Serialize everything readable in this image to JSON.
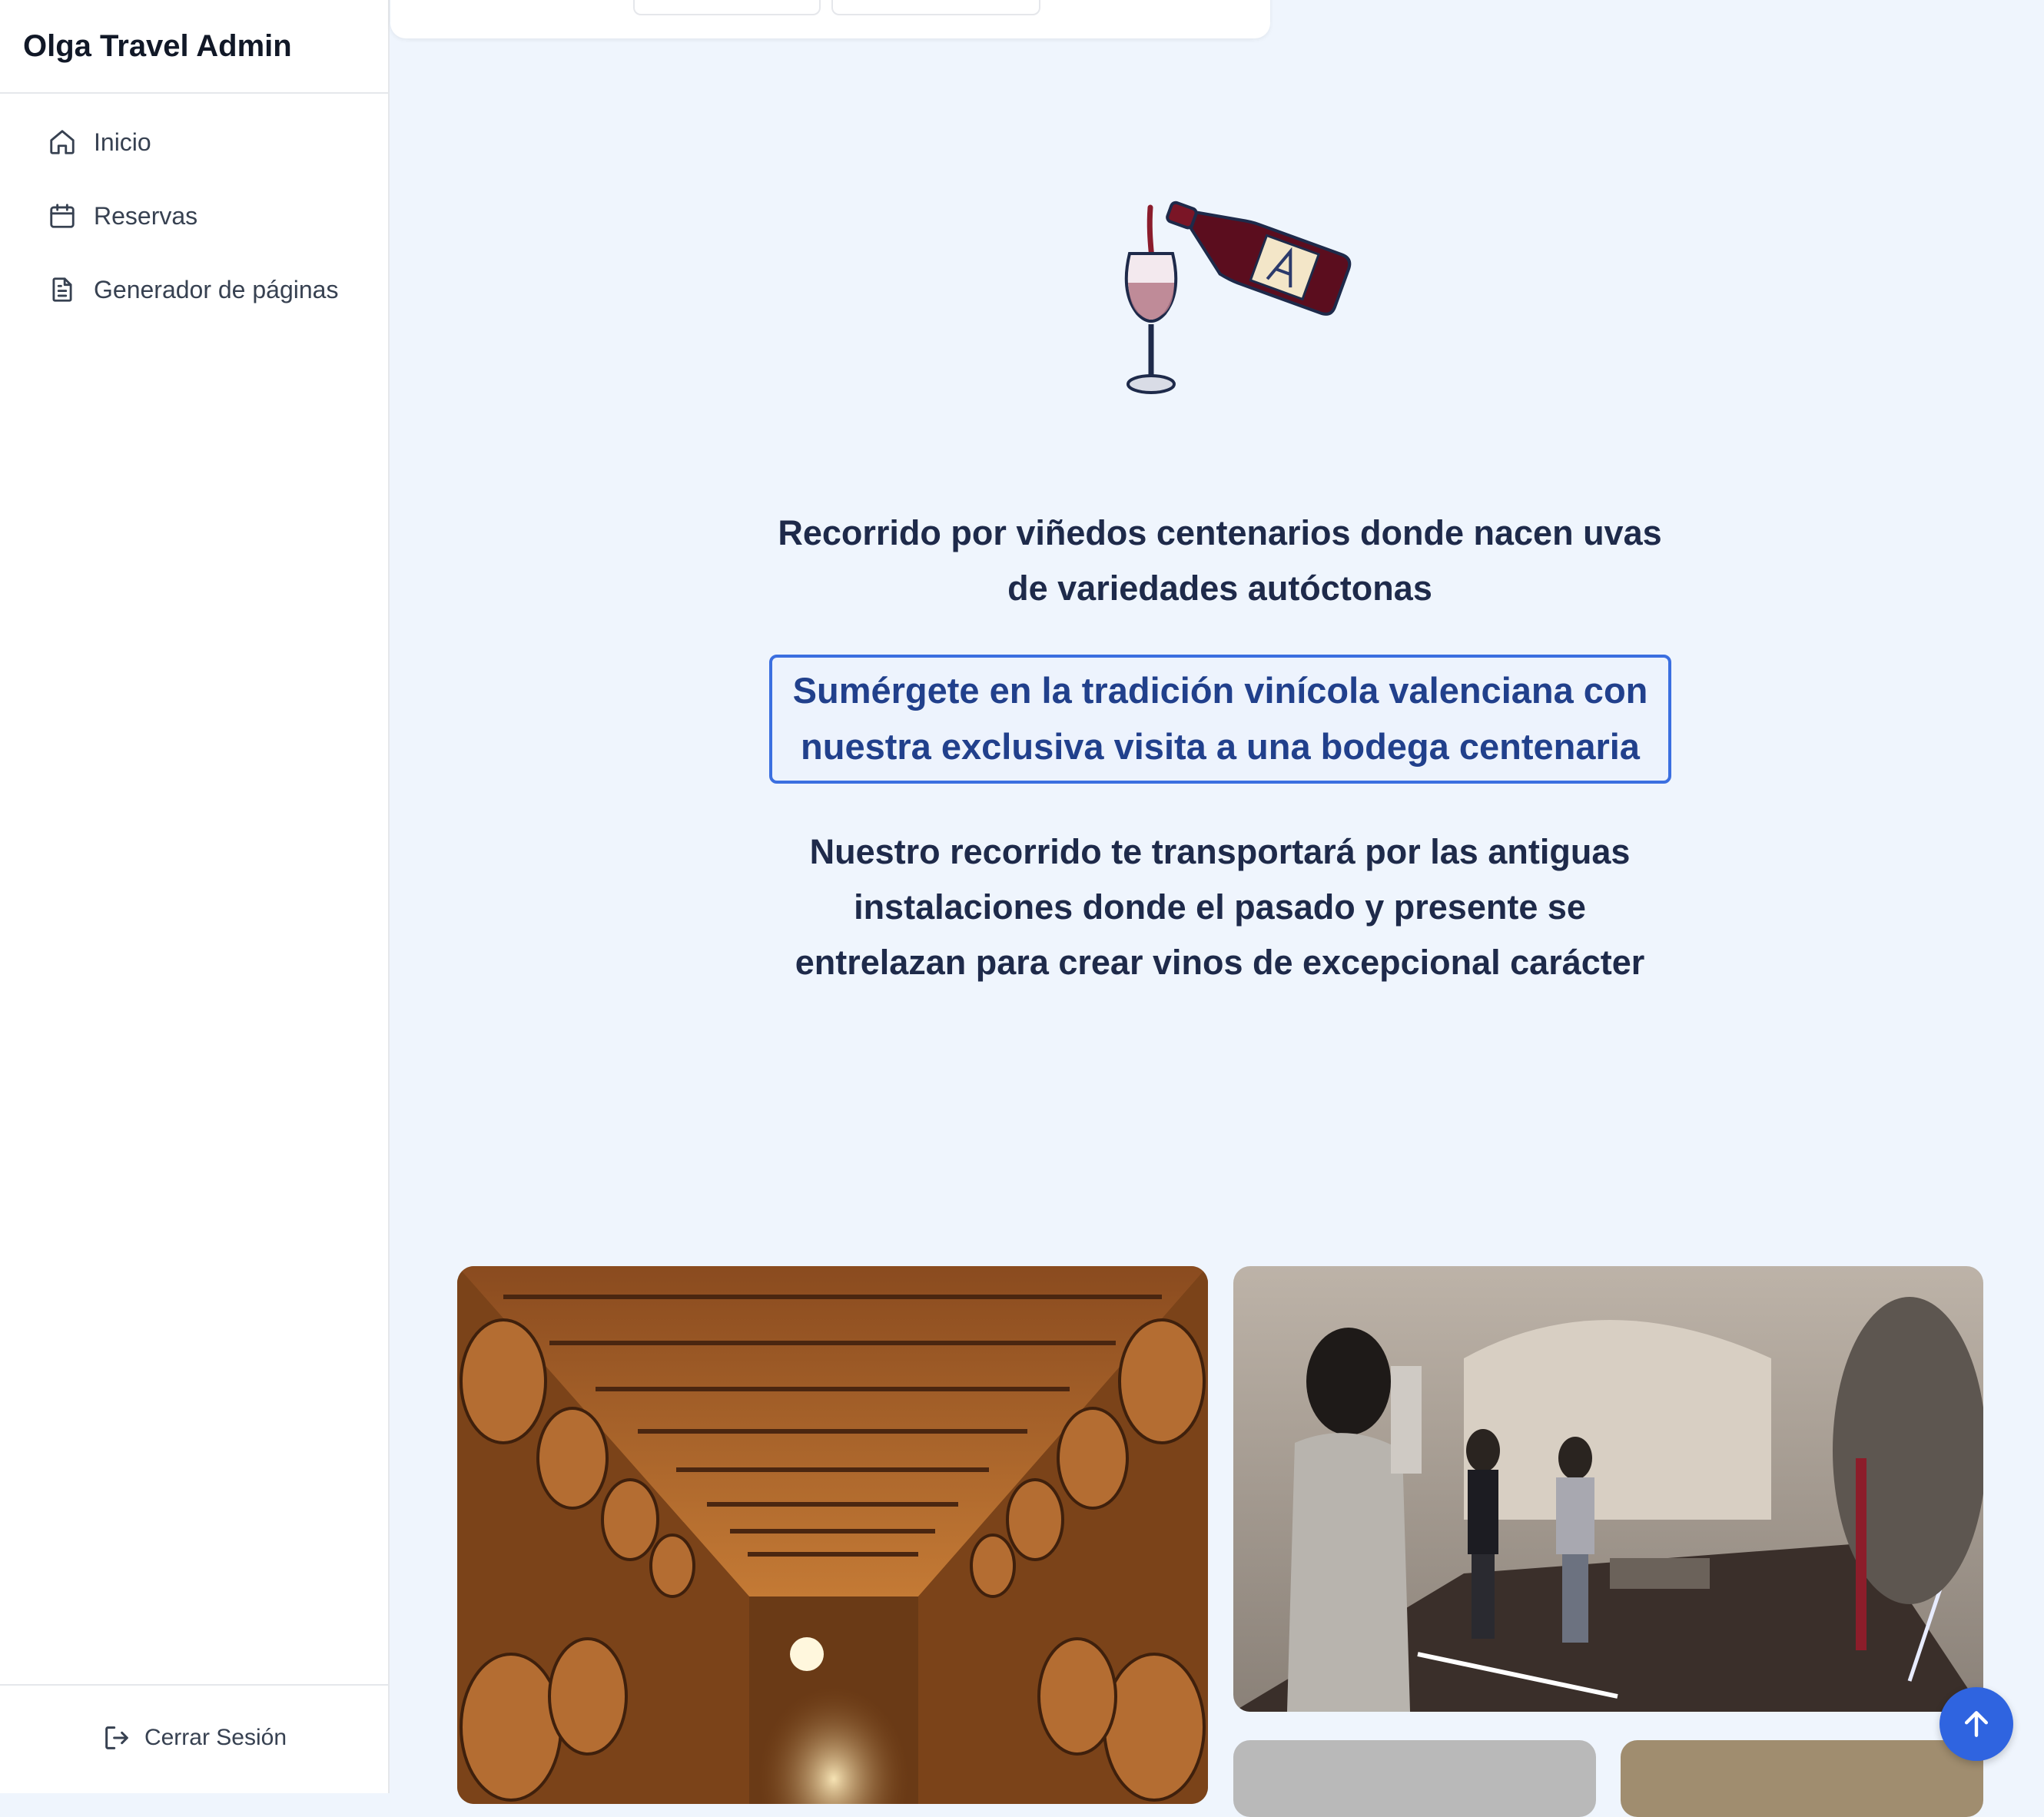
{
  "app": {
    "title": "Olga Travel Admin"
  },
  "sidebar": {
    "items": [
      {
        "label": "Inicio",
        "icon": "home-icon"
      },
      {
        "label": "Reservas",
        "icon": "calendar-icon"
      },
      {
        "label": "Generador de páginas",
        "icon": "document-icon"
      }
    ],
    "logout": {
      "label": "Cerrar Sesión",
      "icon": "logout-icon"
    }
  },
  "content": {
    "heading": "Recorrido por viñedos centenarios donde nacen uvas de variedades autóctonas",
    "editable_text": "Sumérgete en la tradición vinícola valenciana con nuestra exclusiva visita a una bodega centenaria",
    "body": "Nuestro recorrido te transportará por las antiguas instalaciones donde el pasado y presente se entrelazan para crear vinos de excepcional carácter"
  },
  "colors": {
    "background": "#eff5fd",
    "accent": "#2f64e0",
    "text": "#1e2a4a",
    "editing_border": "#3b6fe0"
  }
}
